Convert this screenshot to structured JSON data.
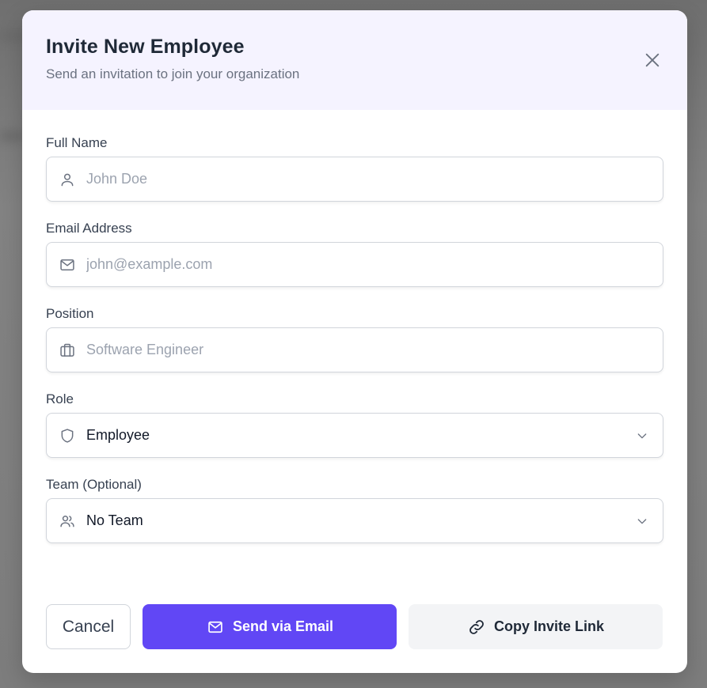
{
  "modal": {
    "title": "Invite New Employee",
    "subtitle": "Send an invitation to join your organization"
  },
  "fields": {
    "full_name": {
      "label": "Full Name",
      "placeholder": "John Doe",
      "value": ""
    },
    "email": {
      "label": "Email Address",
      "placeholder": "john@example.com",
      "value": ""
    },
    "position": {
      "label": "Position",
      "placeholder": "Software Engineer",
      "value": ""
    },
    "role": {
      "label": "Role",
      "selected": "Employee"
    },
    "team": {
      "label": "Team (Optional)",
      "selected": "No Team"
    }
  },
  "actions": {
    "cancel_label": "Cancel",
    "send_label": "Send via Email",
    "copy_label": "Copy Invite Link"
  },
  "colors": {
    "accent": "#6147f5",
    "header_bg": "#f5f3ff",
    "secondary_btn_bg": "#f3f4f6"
  },
  "icons": {
    "close": "close-icon",
    "full_name": "user-icon",
    "email": "mail-icon",
    "position": "briefcase-icon",
    "role": "shield-icon",
    "team": "users-icon",
    "select": "chevron-down-icon",
    "send": "mail-icon",
    "copy": "link-icon"
  }
}
